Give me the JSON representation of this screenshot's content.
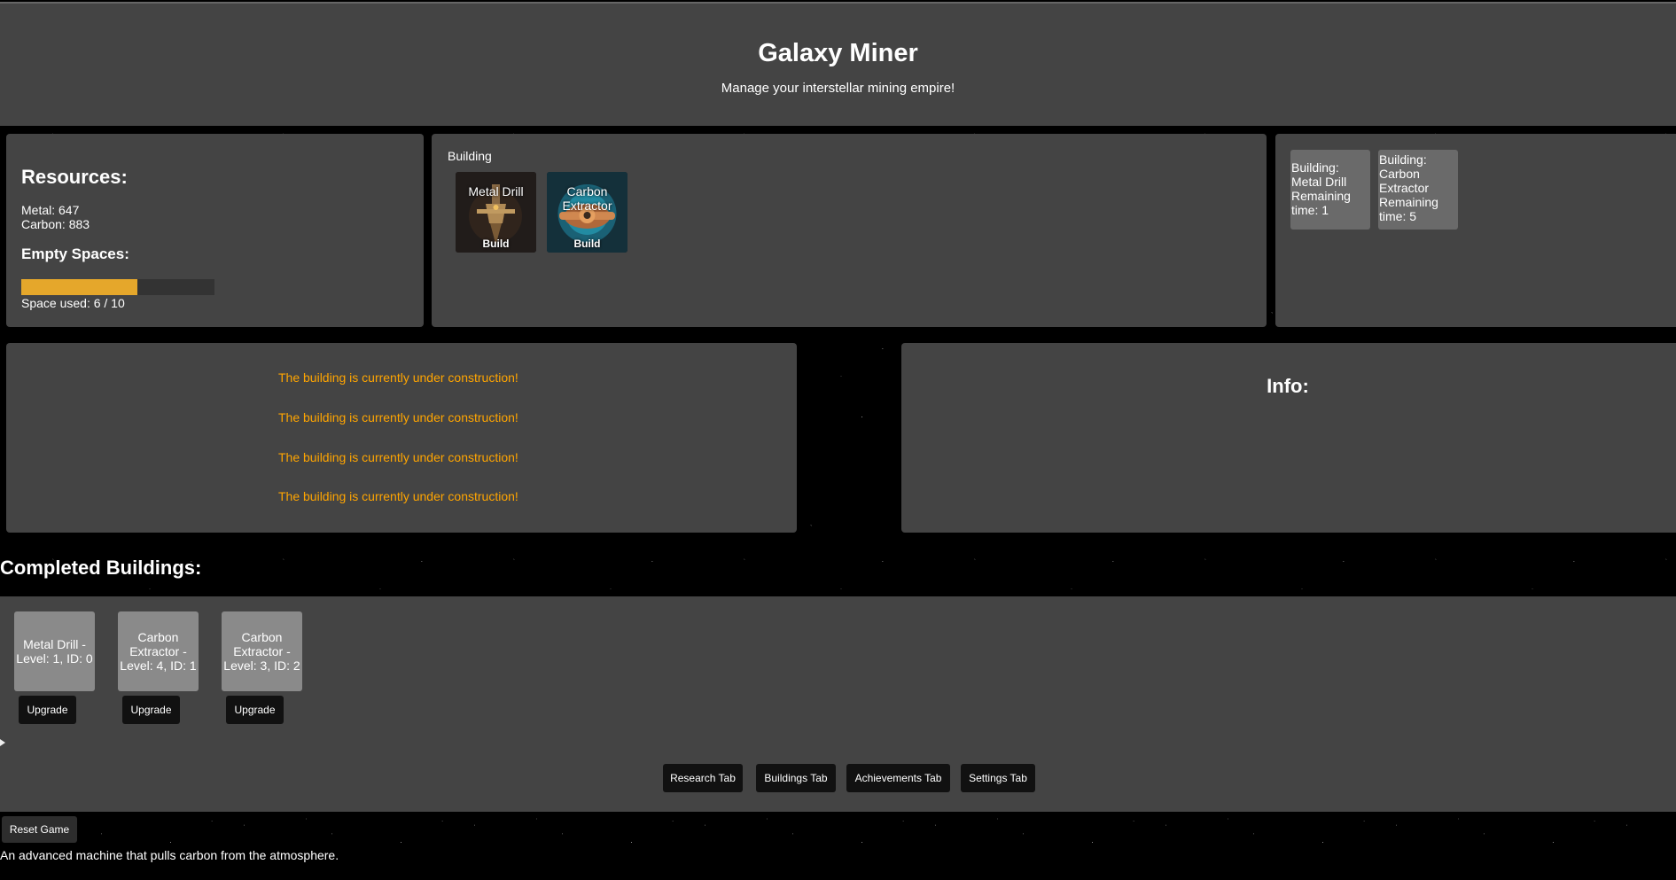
{
  "header": {
    "title": "Galaxy Miner",
    "subtitle": "Manage your interstellar mining empire!"
  },
  "resources": {
    "heading": "Resources:",
    "metal": "Metal: 647",
    "carbon": "Carbon: 883",
    "spaces_heading": "Empty Spaces:",
    "space_used_text": "Space used: 6 / 10",
    "space_used": 6,
    "space_total": 10,
    "bar_color": "#e5a72b"
  },
  "building": {
    "label": "Building",
    "options": [
      {
        "name": "Metal Drill",
        "action": "Build",
        "icon": "metal-drill-icon"
      },
      {
        "name": "Carbon Extractor",
        "action": "Build",
        "icon": "carbon-extractor-icon"
      }
    ]
  },
  "queue": [
    {
      "text": "Building: Metal Drill Remaining time: 1"
    },
    {
      "text": "Building: Carbon Extractor Remaining time: 5"
    }
  ],
  "log": {
    "color": "#ffa500",
    "messages": [
      "The building is currently under construction!",
      "The building is currently under construction!",
      "The building is currently under construction!",
      "The building is currently under construction!"
    ]
  },
  "info": {
    "heading": "Info:"
  },
  "completed": {
    "heading": "Completed Buildings:",
    "items": [
      {
        "label": "Metal Drill - Level: 1, ID: 0",
        "action": "Upgrade"
      },
      {
        "label": "Carbon Extractor - Level: 4, ID: 1",
        "action": "Upgrade"
      },
      {
        "label": "Carbon Extractor - Level: 3, ID: 2",
        "action": "Upgrade"
      }
    ]
  },
  "tabs": [
    {
      "label": "Research Tab"
    },
    {
      "label": "Buildings Tab"
    },
    {
      "label": "Achievements Tab"
    },
    {
      "label": "Settings Tab"
    }
  ],
  "footer": {
    "reset_label": "Reset Game",
    "description": "An advanced machine that pulls carbon from the atmosphere."
  }
}
